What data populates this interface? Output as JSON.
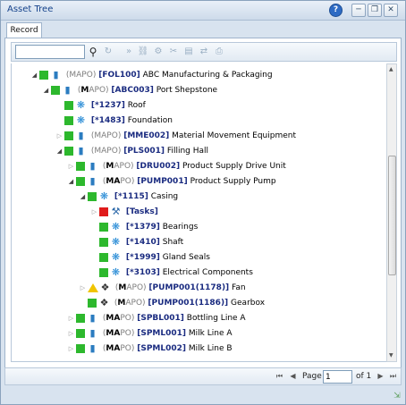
{
  "window": {
    "title": "Asset Tree",
    "help_icon": "help-icon",
    "minimize_icon": "minimize-icon",
    "restore_icon": "restore-icon",
    "close_icon": "close-icon"
  },
  "tabs": [
    {
      "label": "Record"
    }
  ],
  "search": {
    "value": "",
    "placeholder": ""
  },
  "toolbar_icons": [
    "search-icon",
    "refresh-icon",
    "expand-icon",
    "link-icon",
    "unlink-icon",
    "cut-icon",
    "copy-icon",
    "move-icon",
    "paste-icon"
  ],
  "tree": [
    {
      "mapo_prefix": "(MAPO)",
      "code": "[FOL100]",
      "name": "ABC Manufacturing & Packaging"
    },
    {
      "mapo_prefix": "(",
      "mapo_bold": "M",
      "mapo_suffix": "APO)",
      "code": "[ABC003]",
      "name": "Port Shepstone"
    },
    {
      "code": "[*1237]",
      "name": "Roof"
    },
    {
      "code": "[*1483]",
      "name": "Foundation"
    },
    {
      "mapo_prefix": "(MAPO)",
      "code": "[MME002]",
      "name": "Material Movement Equipment"
    },
    {
      "mapo_prefix": "(MAPO)",
      "code": "[PLS001]",
      "name": "Filling Hall"
    },
    {
      "mapo_prefix": "(",
      "mapo_bold": "M",
      "mapo_suffix": "APO)",
      "code": "[DRU002]",
      "name": "Product Supply Drive Unit"
    },
    {
      "mapo_prefix": "(",
      "mapo_bold": "MA",
      "mapo_suffix": "PO)",
      "code": "[PUMP001]",
      "name": "Product Supply Pump"
    },
    {
      "code": "[*1115]",
      "name": "Casing"
    },
    {
      "code": "[Tasks]",
      "name": ""
    },
    {
      "code": "[*1379]",
      "name": "Bearings"
    },
    {
      "code": "[*1410]",
      "name": "Shaft"
    },
    {
      "code": "[*1999]",
      "name": "Gland Seals"
    },
    {
      "code": "[*3103]",
      "name": "Electrical Components"
    },
    {
      "mapo_prefix": "(",
      "mapo_bold": "M",
      "mapo_suffix": "APO)",
      "code": "[PUMP001(1178)]",
      "name": "Fan"
    },
    {
      "mapo_prefix": "(",
      "mapo_bold": "M",
      "mapo_suffix": "APO)",
      "code": "[PUMP001(1186)]",
      "name": "Gearbox"
    },
    {
      "mapo_prefix": "(",
      "mapo_bold": "MA",
      "mapo_suffix": "PO)",
      "code": "[SPBL001]",
      "name": "Bottling Line A"
    },
    {
      "mapo_prefix": "(",
      "mapo_bold": "MA",
      "mapo_suffix": "PO)",
      "code": "[SPML001]",
      "name": "Milk Line A"
    },
    {
      "mapo_prefix": "(",
      "mapo_bold": "MA",
      "mapo_suffix": "PO)",
      "code": "[SPML002]",
      "name": "Milk Line B"
    }
  ],
  "pager": {
    "page_label": "Page",
    "page_value": "1",
    "of_label": "of 1"
  },
  "colors": {
    "status_green": "#2db82d",
    "status_red": "#e01b1b",
    "status_warning": "#f0c400",
    "code_blue": "#1a2b80"
  }
}
